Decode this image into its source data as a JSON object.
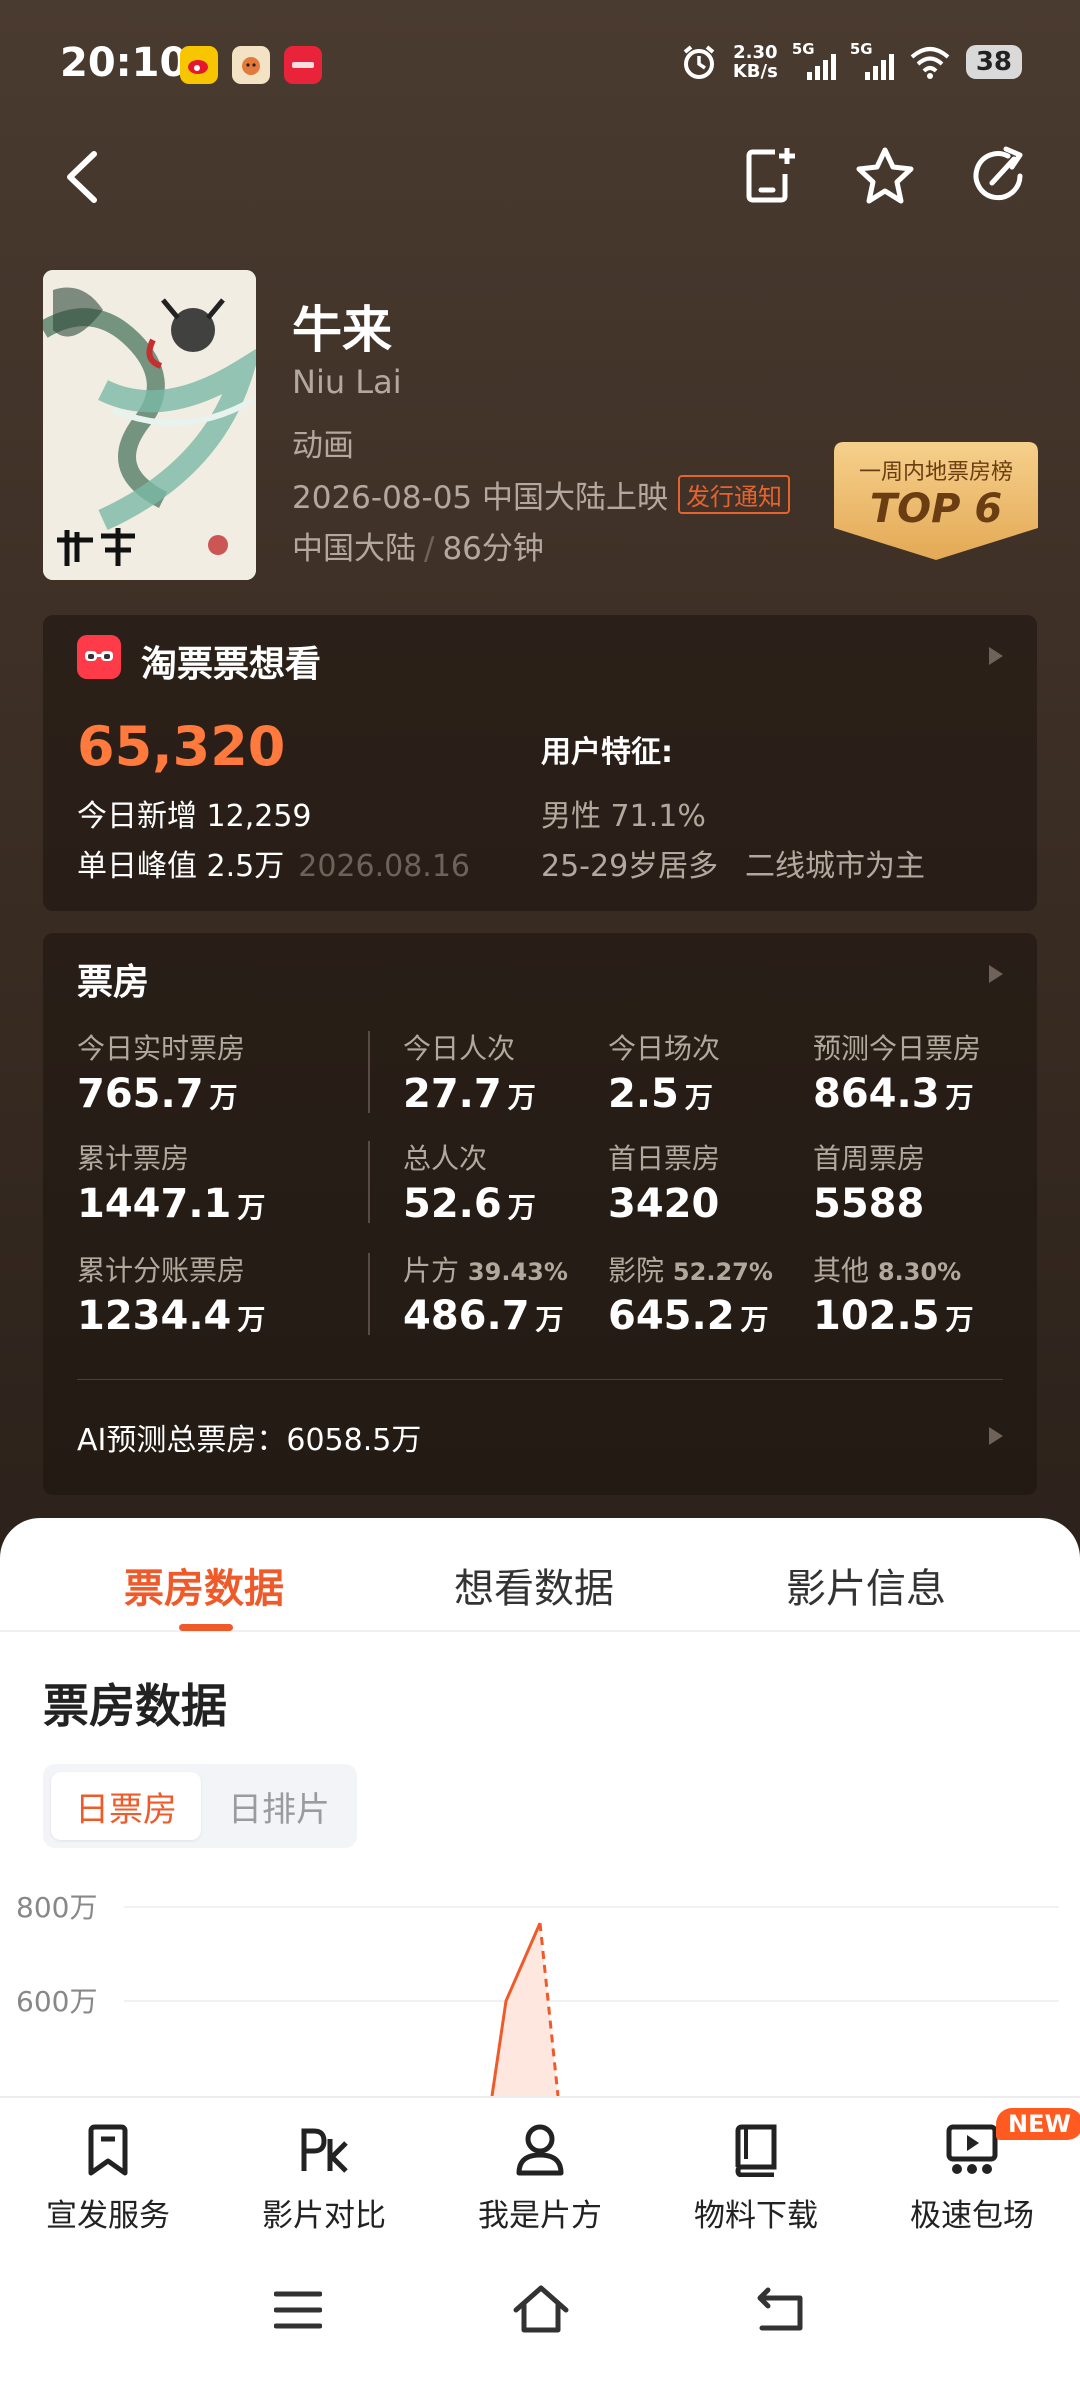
{
  "status_bar": {
    "time": "20:10",
    "net_speed_value": "2.30",
    "net_speed_unit": "KB/s",
    "sim1": "5G",
    "sim2": "5G",
    "battery": "38"
  },
  "movie": {
    "title": "牛来",
    "subtitle": "Niu Lai",
    "genre": "动画",
    "release": "2026-08-05 中国大陆上映",
    "release_badge": "发行通知",
    "region": "中国大陆",
    "duration": "86分钟",
    "rank_badge_top": "一周内地票房榜",
    "rank_badge_main": "TOP 6"
  },
  "want": {
    "title": "淘票票想看",
    "total": "65,320",
    "today_new": "今日新增 12,259",
    "peak": "单日峰值 2.5万",
    "peak_date": "2026.08.16",
    "features_label": "用户特征:",
    "gender": "男性 71.1%",
    "age": "25-29岁居多",
    "city": "二线城市为主"
  },
  "box_office": {
    "title": "票房",
    "cells": [
      {
        "label": "今日实时票房",
        "value": "765.7",
        "unit": "万"
      },
      {
        "label": "今日人次",
        "value": "27.7",
        "unit": "万"
      },
      {
        "label": "今日场次",
        "value": "2.5",
        "unit": "万"
      },
      {
        "label": "预测今日票房",
        "value": "864.3",
        "unit": "万"
      },
      {
        "label": "累计票房",
        "value": "1447.1",
        "unit": "万"
      },
      {
        "label": "总人次",
        "value": "52.6",
        "unit": "万"
      },
      {
        "label": "首日票房",
        "value": "3420",
        "unit": ""
      },
      {
        "label": "首周票房",
        "value": "5588",
        "unit": ""
      },
      {
        "label": "累计分账票房",
        "value": "1234.4",
        "unit": "万"
      },
      {
        "label": "片方",
        "pct": "39.43%",
        "value": "486.7",
        "unit": "万"
      },
      {
        "label": "影院",
        "pct": "52.27%",
        "value": "645.2",
        "unit": "万"
      },
      {
        "label": "其他",
        "pct": "8.30%",
        "value": "102.5",
        "unit": "万"
      }
    ],
    "ai_forecast": "AI预测总票房：6058.5万"
  },
  "tabs": [
    "票房数据",
    "想看数据",
    "影片信息"
  ],
  "section_title": "票房数据",
  "segments": [
    "日票房",
    "日排片"
  ],
  "chart_data": {
    "type": "line",
    "y_ticks": [
      "800万",
      "600万"
    ],
    "ylim": [
      500,
      800
    ],
    "series": [
      {
        "values": [
          0,
          600,
          765.7
        ]
      }
    ],
    "note_forecast_dashed": true
  },
  "toolbar": [
    {
      "label": "宣发服务",
      "icon": "bookmark-icon"
    },
    {
      "label": "影片对比",
      "icon": "pk-icon"
    },
    {
      "label": "我是片方",
      "icon": "user-icon"
    },
    {
      "label": "物料下载",
      "icon": "book-icon"
    },
    {
      "label": "极速包场",
      "icon": "cinema-icon"
    }
  ],
  "new_badge": "NEW",
  "colors": {
    "accent": "#ef5a2a",
    "want_number": "#ff7a3c",
    "dark_bg": "#3a2c22"
  }
}
